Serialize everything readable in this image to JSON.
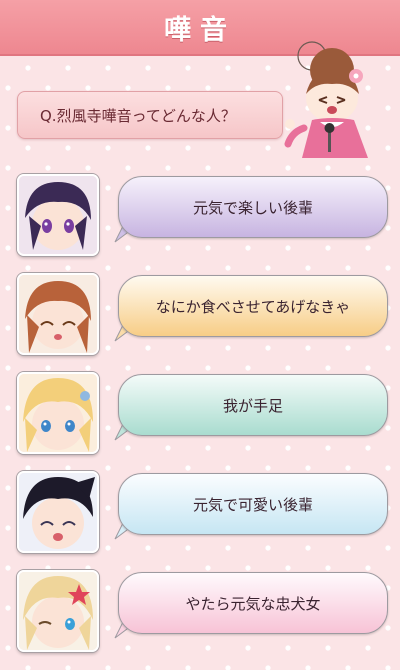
{
  "header": {
    "title": "嘩音"
  },
  "question": {
    "text": "Q.烈風寺嘩音ってどんな人？"
  },
  "answers": [
    {
      "text": "元気で楽しい後輩",
      "top": "#f6f1fb",
      "bottom": "#c7b4e1",
      "hair": "#3b2a55",
      "eye": "#7a3ea0"
    },
    {
      "text": "なにか食べさせてあげなきゃ",
      "top": "#fffaf0",
      "bottom": "#f7cd86",
      "hair": "#b8623a",
      "eye": "#6a3a1a"
    },
    {
      "text": "我が手足",
      "top": "#f4fbf9",
      "bottom": "#a9dccf",
      "hair": "#f3cf7a",
      "eye": "#3f86c9"
    },
    {
      "text": "元気で可愛い後輩",
      "top": "#fbfdff",
      "bottom": "#c6e6f3",
      "hair": "#1d1a2a",
      "eye": "#3a3555"
    },
    {
      "text": "やたら元気な忠犬女",
      "top": "#fffafd",
      "bottom": "#f7c3d6",
      "hair": "#efd59a",
      "eye": "#3aa0d8"
    }
  ]
}
